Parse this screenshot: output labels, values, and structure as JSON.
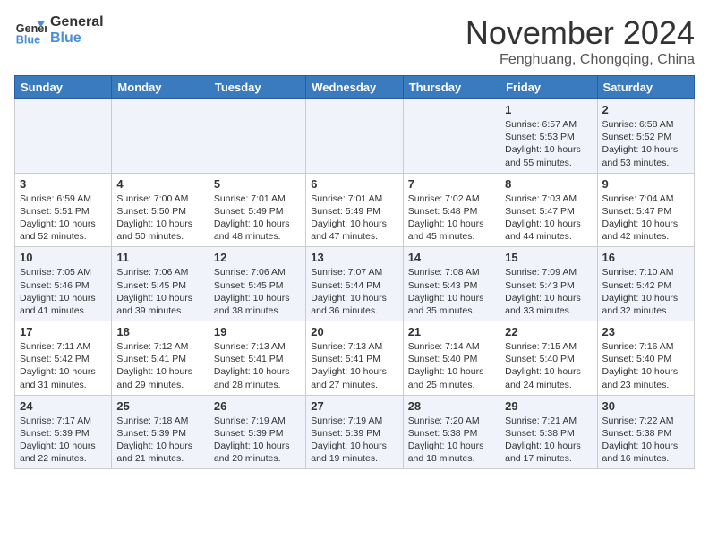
{
  "logo": {
    "line1": "General",
    "line2": "Blue"
  },
  "title": "November 2024",
  "subtitle": "Fenghuang, Chongqing, China",
  "headers": [
    "Sunday",
    "Monday",
    "Tuesday",
    "Wednesday",
    "Thursday",
    "Friday",
    "Saturday"
  ],
  "weeks": [
    [
      {
        "day": "",
        "info": ""
      },
      {
        "day": "",
        "info": ""
      },
      {
        "day": "",
        "info": ""
      },
      {
        "day": "",
        "info": ""
      },
      {
        "day": "",
        "info": ""
      },
      {
        "day": "1",
        "info": "Sunrise: 6:57 AM\nSunset: 5:53 PM\nDaylight: 10 hours\nand 55 minutes."
      },
      {
        "day": "2",
        "info": "Sunrise: 6:58 AM\nSunset: 5:52 PM\nDaylight: 10 hours\nand 53 minutes."
      }
    ],
    [
      {
        "day": "3",
        "info": "Sunrise: 6:59 AM\nSunset: 5:51 PM\nDaylight: 10 hours\nand 52 minutes."
      },
      {
        "day": "4",
        "info": "Sunrise: 7:00 AM\nSunset: 5:50 PM\nDaylight: 10 hours\nand 50 minutes."
      },
      {
        "day": "5",
        "info": "Sunrise: 7:01 AM\nSunset: 5:49 PM\nDaylight: 10 hours\nand 48 minutes."
      },
      {
        "day": "6",
        "info": "Sunrise: 7:01 AM\nSunset: 5:49 PM\nDaylight: 10 hours\nand 47 minutes."
      },
      {
        "day": "7",
        "info": "Sunrise: 7:02 AM\nSunset: 5:48 PM\nDaylight: 10 hours\nand 45 minutes."
      },
      {
        "day": "8",
        "info": "Sunrise: 7:03 AM\nSunset: 5:47 PM\nDaylight: 10 hours\nand 44 minutes."
      },
      {
        "day": "9",
        "info": "Sunrise: 7:04 AM\nSunset: 5:47 PM\nDaylight: 10 hours\nand 42 minutes."
      }
    ],
    [
      {
        "day": "10",
        "info": "Sunrise: 7:05 AM\nSunset: 5:46 PM\nDaylight: 10 hours\nand 41 minutes."
      },
      {
        "day": "11",
        "info": "Sunrise: 7:06 AM\nSunset: 5:45 PM\nDaylight: 10 hours\nand 39 minutes."
      },
      {
        "day": "12",
        "info": "Sunrise: 7:06 AM\nSunset: 5:45 PM\nDaylight: 10 hours\nand 38 minutes."
      },
      {
        "day": "13",
        "info": "Sunrise: 7:07 AM\nSunset: 5:44 PM\nDaylight: 10 hours\nand 36 minutes."
      },
      {
        "day": "14",
        "info": "Sunrise: 7:08 AM\nSunset: 5:43 PM\nDaylight: 10 hours\nand 35 minutes."
      },
      {
        "day": "15",
        "info": "Sunrise: 7:09 AM\nSunset: 5:43 PM\nDaylight: 10 hours\nand 33 minutes."
      },
      {
        "day": "16",
        "info": "Sunrise: 7:10 AM\nSunset: 5:42 PM\nDaylight: 10 hours\nand 32 minutes."
      }
    ],
    [
      {
        "day": "17",
        "info": "Sunrise: 7:11 AM\nSunset: 5:42 PM\nDaylight: 10 hours\nand 31 minutes."
      },
      {
        "day": "18",
        "info": "Sunrise: 7:12 AM\nSunset: 5:41 PM\nDaylight: 10 hours\nand 29 minutes."
      },
      {
        "day": "19",
        "info": "Sunrise: 7:13 AM\nSunset: 5:41 PM\nDaylight: 10 hours\nand 28 minutes."
      },
      {
        "day": "20",
        "info": "Sunrise: 7:13 AM\nSunset: 5:41 PM\nDaylight: 10 hours\nand 27 minutes."
      },
      {
        "day": "21",
        "info": "Sunrise: 7:14 AM\nSunset: 5:40 PM\nDaylight: 10 hours\nand 25 minutes."
      },
      {
        "day": "22",
        "info": "Sunrise: 7:15 AM\nSunset: 5:40 PM\nDaylight: 10 hours\nand 24 minutes."
      },
      {
        "day": "23",
        "info": "Sunrise: 7:16 AM\nSunset: 5:40 PM\nDaylight: 10 hours\nand 23 minutes."
      }
    ],
    [
      {
        "day": "24",
        "info": "Sunrise: 7:17 AM\nSunset: 5:39 PM\nDaylight: 10 hours\nand 22 minutes."
      },
      {
        "day": "25",
        "info": "Sunrise: 7:18 AM\nSunset: 5:39 PM\nDaylight: 10 hours\nand 21 minutes."
      },
      {
        "day": "26",
        "info": "Sunrise: 7:19 AM\nSunset: 5:39 PM\nDaylight: 10 hours\nand 20 minutes."
      },
      {
        "day": "27",
        "info": "Sunrise: 7:19 AM\nSunset: 5:39 PM\nDaylight: 10 hours\nand 19 minutes."
      },
      {
        "day": "28",
        "info": "Sunrise: 7:20 AM\nSunset: 5:38 PM\nDaylight: 10 hours\nand 18 minutes."
      },
      {
        "day": "29",
        "info": "Sunrise: 7:21 AM\nSunset: 5:38 PM\nDaylight: 10 hours\nand 17 minutes."
      },
      {
        "day": "30",
        "info": "Sunrise: 7:22 AM\nSunset: 5:38 PM\nDaylight: 10 hours\nand 16 minutes."
      }
    ]
  ]
}
